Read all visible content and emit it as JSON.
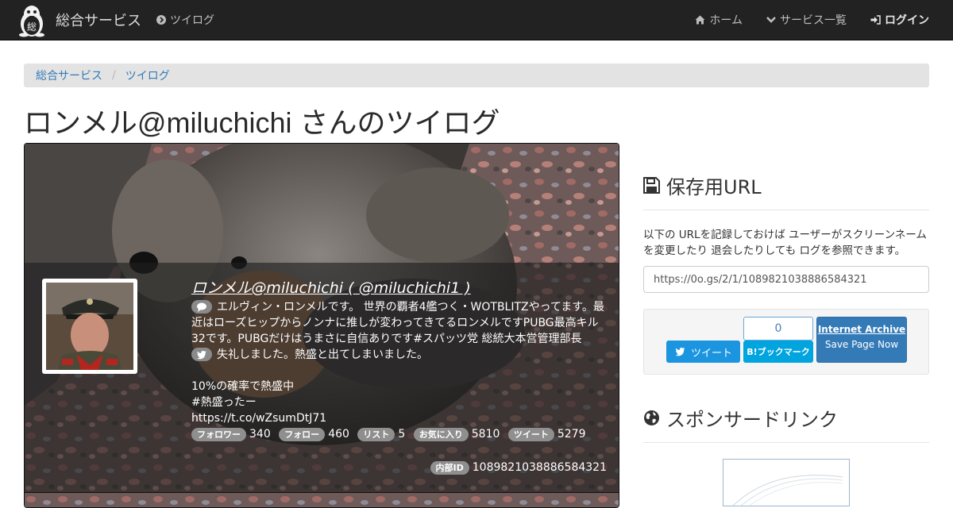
{
  "navbar": {
    "brand": "総合サービス",
    "brand_logo_char": "総",
    "left_item": "ツイログ",
    "right_items": [
      {
        "label": "ホーム",
        "icon": "home-icon"
      },
      {
        "label": "サービス一覧",
        "icon": "chevron-down-icon"
      },
      {
        "label": "ログイン",
        "icon": "sign-in-icon"
      }
    ]
  },
  "breadcrumb": [
    "総合サービス",
    "ツイログ"
  ],
  "page_title": "ロンメル@miluchichi さんのツイログ",
  "profile": {
    "name_line": "ロンメル@miluchichi ( @miluchichi1 )",
    "description": [
      "エルヴィン・ロンメルです。 世界の覇者4艦つく・WOTBLITZやってます。最",
      "近はローズヒップからノンナに推しが変わってきてるロンメルですPUBG最高キル",
      "32です。PUBGだけはうまさに自信ありです#スパッツ党 総統大本営管理部長"
    ],
    "tweet_lines": [
      "失礼しました。熱盛と出てしまいました。"
    ],
    "tweet_lines_2": [
      "10%の確率で熱盛中",
      "#熱盛ったー",
      "https://t.co/wZsumDtJ71"
    ],
    "stats": [
      {
        "label": "フォロワー",
        "value": "340"
      },
      {
        "label": "フォロー",
        "value": "460"
      },
      {
        "label": "リスト",
        "value": "5"
      },
      {
        "label": "お気に入り",
        "value": "5810"
      },
      {
        "label": "ツイート",
        "value": "5279"
      }
    ],
    "internal_id_label": "内部ID",
    "internal_id": "1089821038886584321"
  },
  "sidebar": {
    "save_heading": "保存用URL",
    "save_desc": "以下の URLを記録しておけば ユーザーがスクリーンネームを変更したり 退会したりしても ログを参照できます。",
    "save_url": "https://0o.gs/2/1/1089821038886584321",
    "tweet_button": "ツイート",
    "hatena_count": "0",
    "hatena_button": "ブックマーク",
    "hatena_b": "B!",
    "ia_title": "Internet Archive",
    "ia_sub": "Save Page Now",
    "sponsor_heading": "スポンサードリンク"
  }
}
